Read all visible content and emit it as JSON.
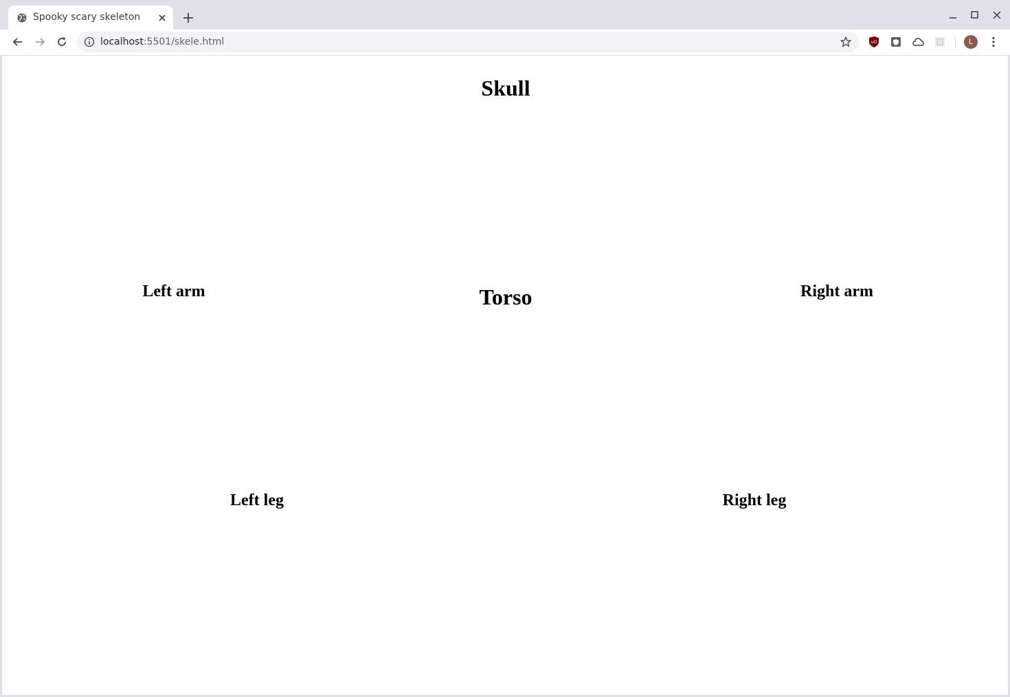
{
  "browser": {
    "tab_title": "Spooky scary skeleton",
    "url_host": "localhost",
    "url_rest": ":5501/skele.html",
    "avatar_letter": "L",
    "icons": [
      "globe-icon",
      "close-icon",
      "plus-icon",
      "minimize-icon",
      "maximize-icon",
      "window-close-icon",
      "back-icon",
      "forward-icon",
      "reload-icon",
      "info-icon",
      "star-icon",
      "ublock-icon",
      "shield-extension-icon",
      "cloud-icon",
      "puzzle-extension-icon",
      "more-menu-icon"
    ]
  },
  "page": {
    "skull": "Skull",
    "torso": "Torso",
    "left_arm": "Left arm",
    "right_arm": "Right arm",
    "left_leg": "Left leg",
    "right_leg": "Right leg"
  }
}
